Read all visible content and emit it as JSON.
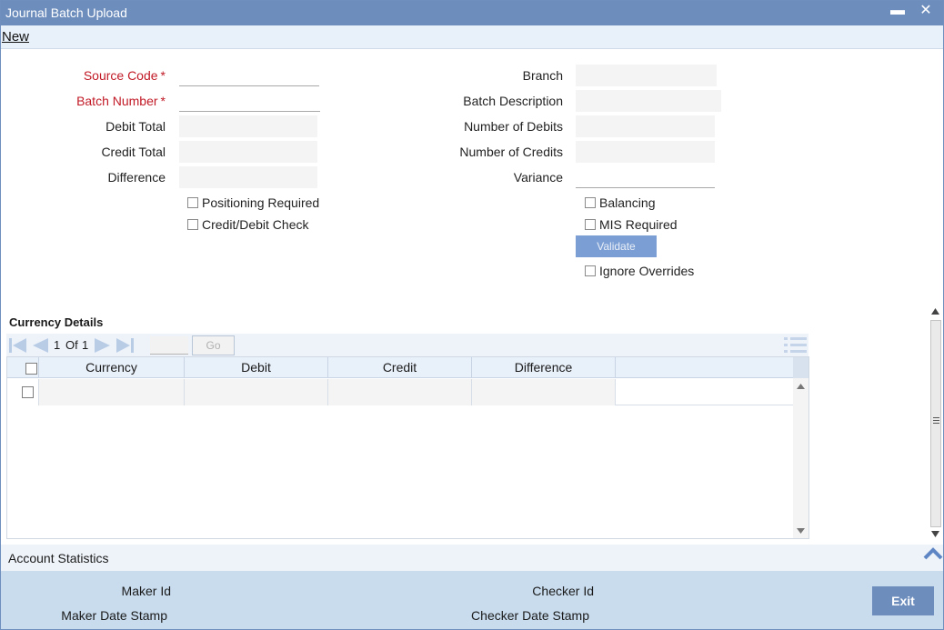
{
  "window": {
    "title": "Journal Batch Upload",
    "minimize_glyph": "▬",
    "close_glyph": "✕"
  },
  "menu": {
    "new_label": "New"
  },
  "form": {
    "source_code_label": "Source Code",
    "batch_number_label": "Batch Number",
    "debit_total_label": "Debit Total",
    "credit_total_label": "Credit Total",
    "difference_label": "Difference",
    "branch_label": "Branch",
    "batch_description_label": "Batch Description",
    "number_of_debits_label": "Number of Debits",
    "number_of_credits_label": "Number of Credits",
    "variance_label": "Variance",
    "required_mark": "*",
    "positioning_required_label": "Positioning Required",
    "credit_debit_check_label": "Credit/Debit Check",
    "balancing_label": "Balancing",
    "mis_required_label": "MIS Required",
    "validate_label": "Validate",
    "ignore_overrides_label": "Ignore Overrides"
  },
  "currency_details": {
    "title": "Currency Details",
    "pager": {
      "current": "1",
      "of_label": "Of",
      "total": "1",
      "go_label": "Go"
    },
    "columns": [
      "Currency",
      "Debit",
      "Credit",
      "Difference"
    ]
  },
  "account_statistics": {
    "title": "Account Statistics",
    "maker_id_label": "Maker Id",
    "maker_date_stamp_label": "Maker Date Stamp",
    "checker_id_label": "Checker Id",
    "checker_date_stamp_label": "Checker Date Stamp"
  },
  "footer": {
    "exit_label": "Exit"
  },
  "colors": {
    "titlebar": "#6d8dbd",
    "required": "#c11a26",
    "validate_button": "#7b9fd4",
    "footer": "#c8dcee"
  },
  "icons": [
    "minimize-icon",
    "close-icon",
    "first-page-icon",
    "prev-page-icon",
    "next-page-icon",
    "last-page-icon",
    "column-menu-icon",
    "chevron-up-icon"
  ]
}
